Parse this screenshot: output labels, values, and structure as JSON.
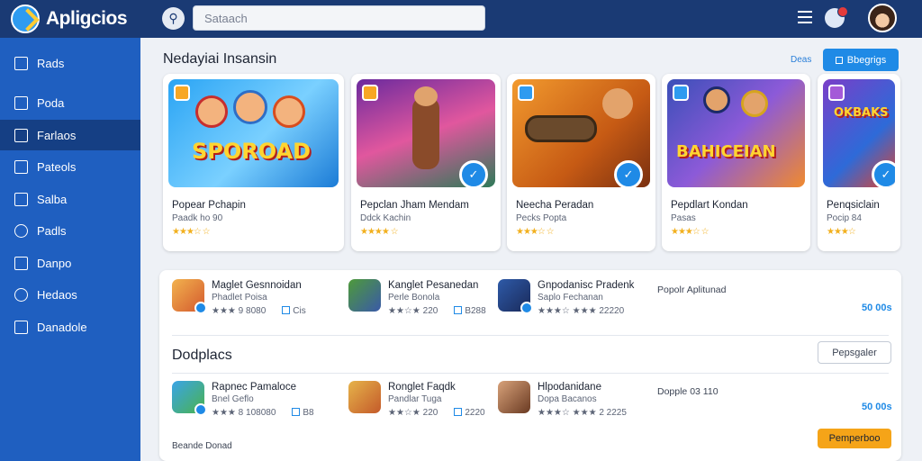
{
  "header": {
    "app_title": "Apligcios",
    "search_placeholder": "Sataach",
    "search_icon": "search-icon",
    "menu_icon": "menu-icon",
    "notification_icon": "bell-icon"
  },
  "sidebar": {
    "items": [
      {
        "label": "Rads",
        "icon": "home-icon"
      },
      {
        "label": "Poda",
        "icon": "grid-icon"
      },
      {
        "label": "Farlaos",
        "icon": "folder-icon"
      },
      {
        "label": "Pateols",
        "icon": "home-icon"
      },
      {
        "label": "Salba",
        "icon": "square-icon"
      },
      {
        "label": "Padls",
        "icon": "circle-icon"
      },
      {
        "label": "Danpo",
        "icon": "list-icon"
      },
      {
        "label": "Hedaos",
        "icon": "eye-icon"
      },
      {
        "label": "Danadole",
        "icon": "download-icon"
      }
    ]
  },
  "featured": {
    "title": "Nedayiai Insansin",
    "link": "Deas",
    "button": "Bbegrigs",
    "cards": [
      {
        "art": "SPOROAD",
        "name": "Popear Pchapin",
        "sub": "Paadk ho 90",
        "rating": "★★★☆ ☆"
      },
      {
        "art": "",
        "name": "Pepclan Jham Mendam",
        "sub": "Ddck Kachin",
        "rating": "★★★★ ☆"
      },
      {
        "art": "",
        "name": "Neecha Peradan",
        "sub": "Pecks Popta",
        "rating": "★★★☆ ☆"
      },
      {
        "art": "BAHICEIAN",
        "name": "Pepdlart Kondan",
        "sub": "Pasas",
        "rating": "★★★☆ ☆"
      },
      {
        "art": "OKBAKS",
        "name": "Penqsiclain",
        "sub": "Pocip 84",
        "rating": "★★★☆"
      }
    ]
  },
  "list1": [
    {
      "name": "Maglet Gesnnoidan",
      "sub": "Phadlet Poisa",
      "meta_left": "★★★ 9 8080",
      "meta_right": "Cis"
    },
    {
      "name": "Kanglet Pesanedan",
      "sub": "Perle Bonola",
      "meta_left": "★★☆★ 220",
      "meta_right": "B288"
    },
    {
      "name": "Gnpodanisc Pradenk",
      "sub": "Saplo Fechanan",
      "meta_left": "★★★☆ ★★★",
      "meta_right": "22220"
    }
  ],
  "list1_side": {
    "note": "Popolr Aplitunad",
    "price": "50 00s"
  },
  "section2": {
    "title": "Dodplacs",
    "button": "Pepsgaler"
  },
  "list2": [
    {
      "name": "Rapnec Pamaloce",
      "sub": "Bnel Geflo",
      "meta_left": "★★★ 8 108080",
      "meta_right": "B8"
    },
    {
      "name": "Ronglet Faqdk",
      "sub": "Pandlar Tuga",
      "meta_left": "★★☆★ 220",
      "meta_right": "2220"
    },
    {
      "name": "Hlpodanidane",
      "sub": "Dopa Bacanos",
      "meta_left": "★★★☆ ★★★",
      "meta_right": "2 2225"
    }
  ],
  "list2_side": {
    "note": "Dopple 03 110",
    "price": "50 00s"
  },
  "footer": {
    "label": "Beande Donad",
    "orange_button": "Pemperboo"
  },
  "colors": {
    "topbar": "#1a3a74",
    "sidebar": "#1f5fc0",
    "sidebar_active": "#153f84",
    "accent": "#1f8ae6",
    "orange": "#f5a418"
  }
}
